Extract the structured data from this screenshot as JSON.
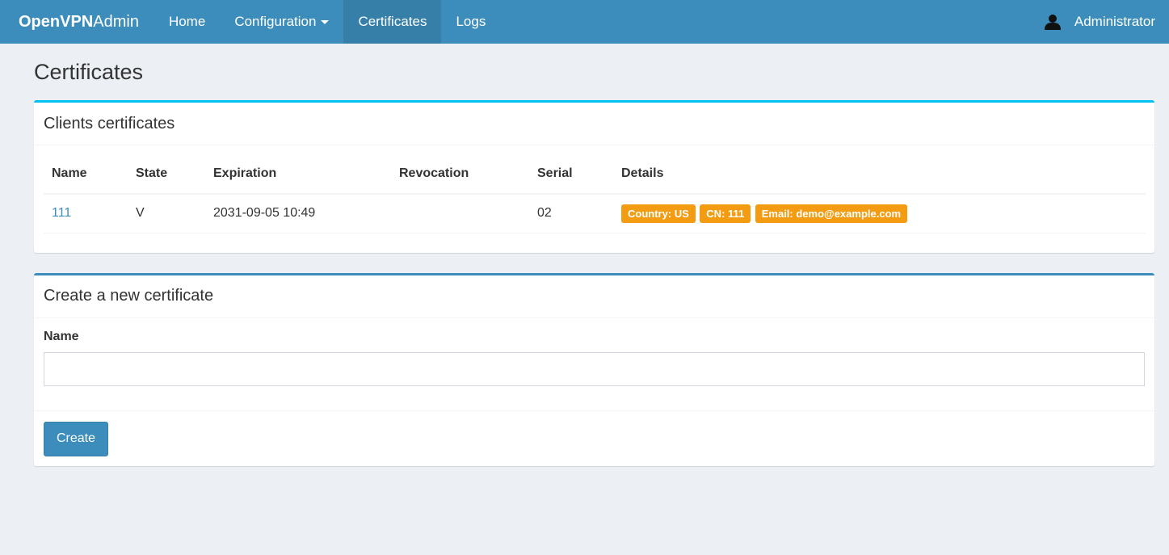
{
  "navbar": {
    "brand_bold": "OpenVPN",
    "brand_rest": "Admin",
    "items": [
      {
        "label": "Home"
      },
      {
        "label": "Configuration"
      },
      {
        "label": "Certificates"
      },
      {
        "label": "Logs"
      }
    ],
    "user": "Administrator"
  },
  "page": {
    "title": "Certificates"
  },
  "clients": {
    "title": "Clients certificates",
    "columns": [
      "Name",
      "State",
      "Expiration",
      "Revocation",
      "Serial",
      "Details"
    ],
    "rows": [
      {
        "name": "111",
        "state": "V",
        "expiration": "2031-09-05 10:49",
        "revocation": "",
        "serial": "02",
        "details": [
          "Country: US",
          "CN: 111",
          "Email: demo@example.com"
        ]
      }
    ]
  },
  "create": {
    "title": "Create a new certificate",
    "name_label": "Name",
    "name_value": "",
    "button": "Create"
  },
  "colors": {
    "navbar": "#3c8dbc",
    "active_nav": "#367fa9",
    "info_border": "#00c0ef",
    "badge": "#f39c12"
  }
}
